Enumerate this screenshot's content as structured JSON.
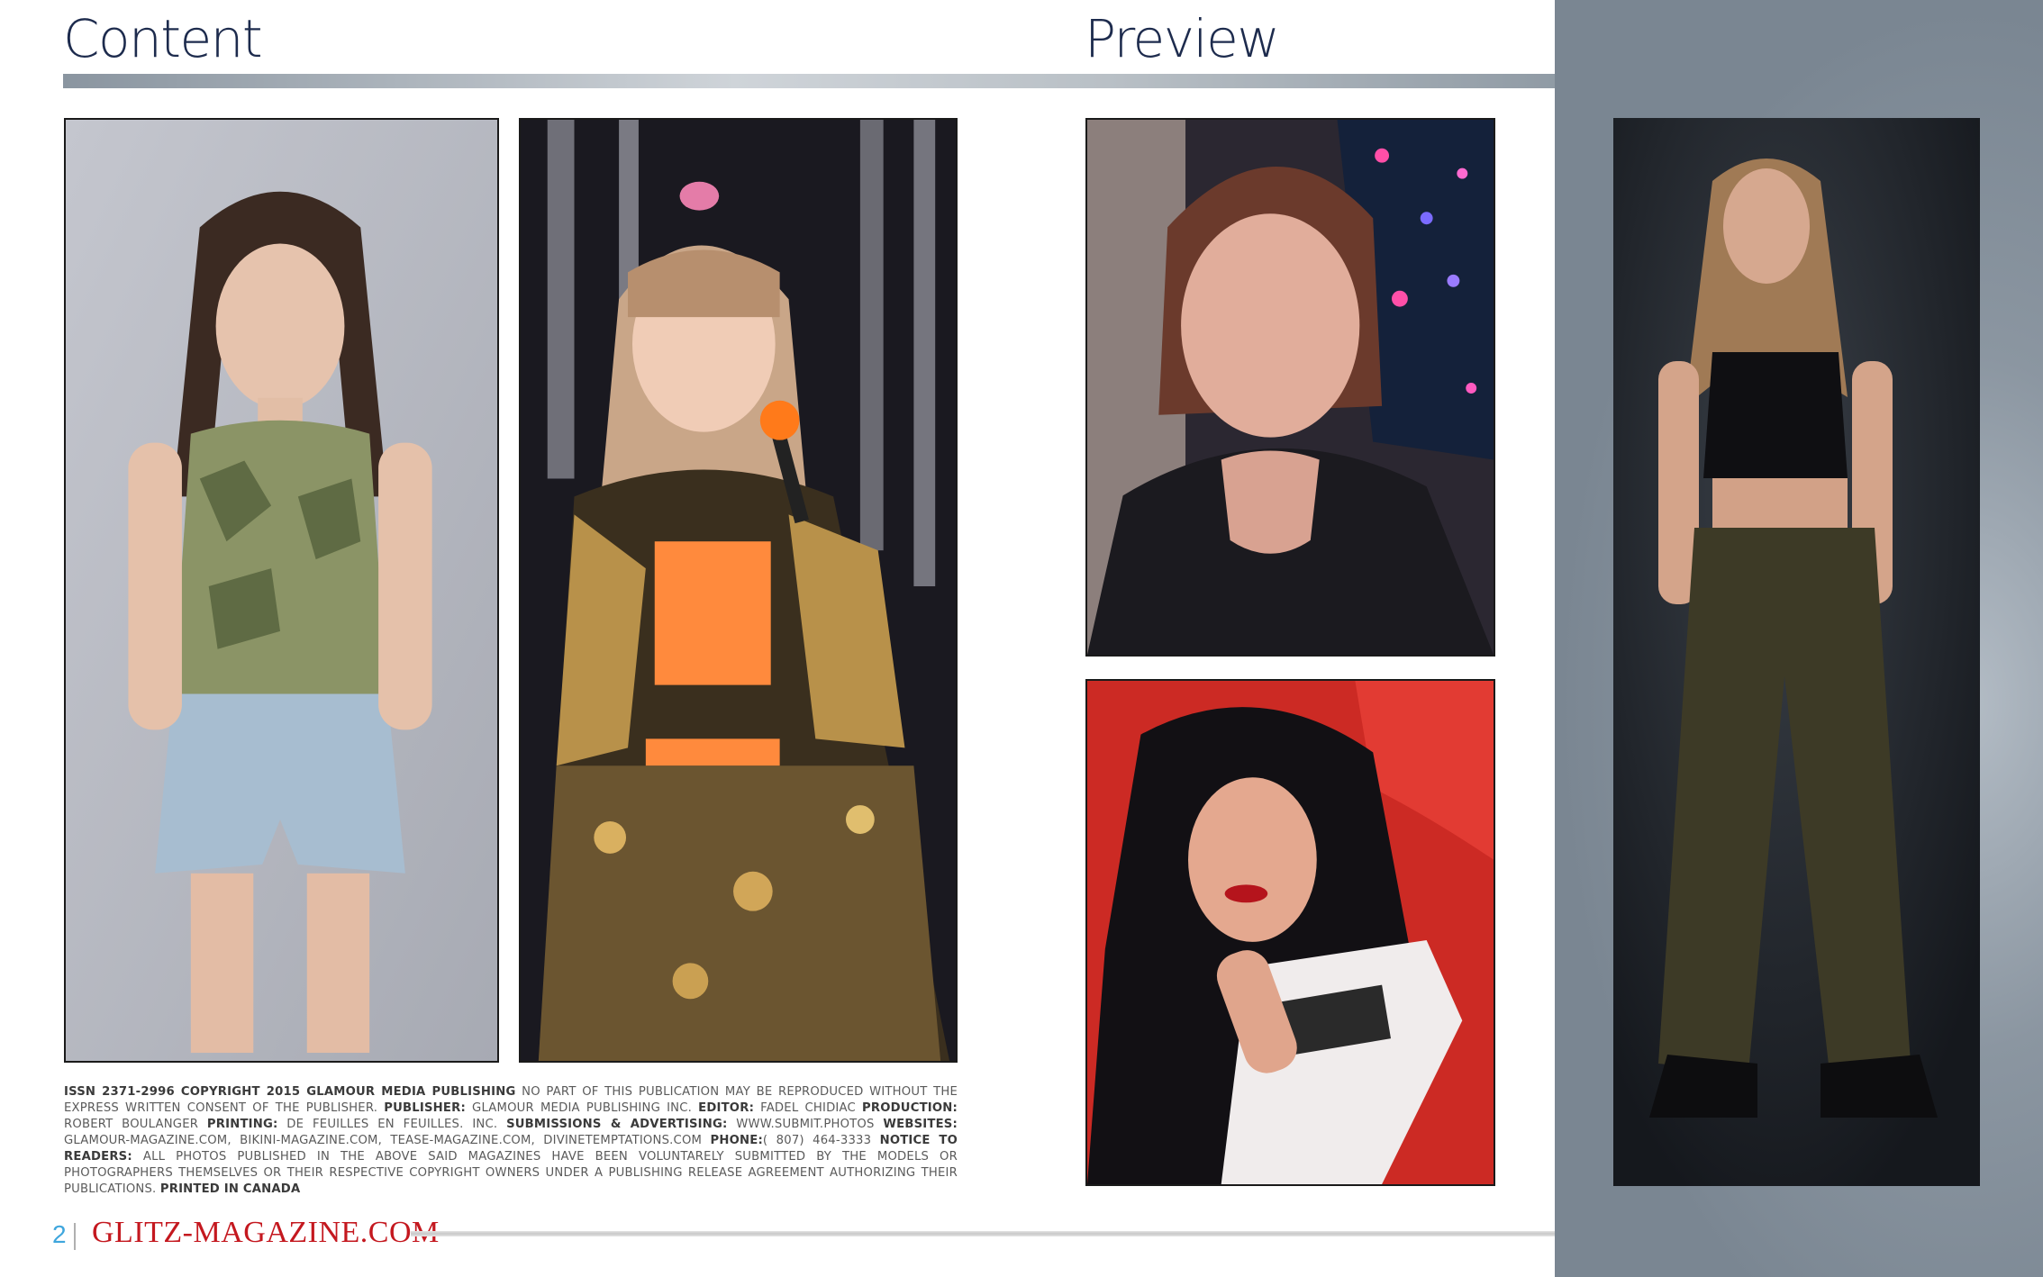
{
  "headings": {
    "left": "Content",
    "right": "Preview"
  },
  "colors": {
    "heading": "#1d2b4d",
    "page_number": "#3fa6dd",
    "logo": "#c4181f",
    "side_panel": "#7a8692"
  },
  "fineprint": [
    {
      "bold": true,
      "text": "ISSN 2371-2996 COPYRIGHT 2015 GLAMOUR MEDIA PUBLISHING"
    },
    {
      "bold": false,
      "text": " NO PART OF THIS PUBLICATION MAY BE REPRODUCED WITHOUT THE EXPRESS WRITTEN CONSENT OF THE PUBLISHER. "
    },
    {
      "bold": true,
      "text": "PUBLISHER:"
    },
    {
      "bold": false,
      "text": " GLAMOUR MEDIA PUBLISHING INC. "
    },
    {
      "bold": true,
      "text": "EDITOR:"
    },
    {
      "bold": false,
      "text": " FADEL CHIDIAC "
    },
    {
      "bold": true,
      "text": "PRODUCTION:"
    },
    {
      "bold": false,
      "text": " ROBERT BOULANGER "
    },
    {
      "bold": true,
      "text": "PRINTING:"
    },
    {
      "bold": false,
      "text": " DE FEUILLES EN FEUILLES. INC. "
    },
    {
      "bold": true,
      "text": "SUBMISSIONS & ADVERTISING:"
    },
    {
      "bold": false,
      "text": " WWW.SUBMIT.PHOTOS "
    },
    {
      "bold": true,
      "text": "WEBSITES:"
    },
    {
      "bold": false,
      "text": " GLAMOUR-MAGAZINE.COM, BIKINI-MAGAZINE.COM, TEASE-MAGAZINE.COM, DIVINETEMPTATIONS.COM "
    },
    {
      "bold": true,
      "text": "PHONE:"
    },
    {
      "bold": false,
      "text": "( 807) 464-3333 "
    },
    {
      "bold": true,
      "text": "NOTICE TO READERS:"
    },
    {
      "bold": false,
      "text": " ALL PHOTOS PUBLISHED IN THE ABOVE SAID MAGAZINES HAVE BEEN VOLUNTARELY SUBMITTED BY THE MODELS OR PHOTOGRAPHERS THEMSELVES OR THEIR RESPECTIVE COPYRIGHT OWNERS UNDER A PUBLISHING RELEASE AGREEMENT AUTHORIZING THEIR PUBLICATIONS. "
    },
    {
      "bold": true,
      "text": "PRINTED IN CANADA"
    }
  ],
  "footer": {
    "page_number": "2",
    "logo": "GLITZ-MAGAZINE.COM"
  }
}
